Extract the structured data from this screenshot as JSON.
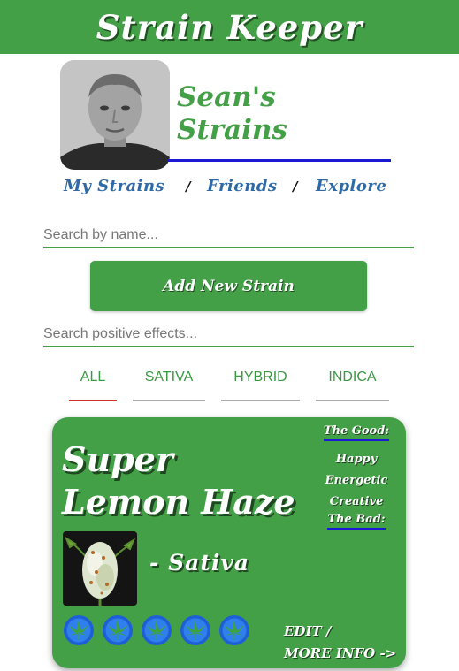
{
  "app": {
    "title": "Strain Keeper"
  },
  "profile": {
    "title_line1": "Sean's",
    "title_line2": "Strains"
  },
  "nav": {
    "items": [
      "My Strains",
      "Friends",
      "Explore"
    ],
    "separator": "/"
  },
  "search": {
    "name_placeholder": "Search by name...",
    "effects_placeholder": "Search positive effects..."
  },
  "actions": {
    "add_label": "Add New Strain"
  },
  "tabs": [
    {
      "label": "ALL",
      "active": true
    },
    {
      "label": "SATIVA",
      "active": false
    },
    {
      "label": "HYBRID",
      "active": false
    },
    {
      "label": "INDICA",
      "active": false
    }
  ],
  "strain": {
    "name_line1": "Super",
    "name_line2": "Lemon Haze",
    "type": "- Sativa",
    "good_heading": "The Good:",
    "good_effects": [
      "Happy",
      "Energetic",
      "Creative"
    ],
    "bad_heading": "The Bad:",
    "rating": 5,
    "rating_max": 5,
    "more_line1": "EDIT /",
    "more_line2": "MORE INFO ->"
  },
  "colors": {
    "brand_green": "#43a047",
    "link_blue": "#2f6aa8",
    "underline_blue": "#1a1ad4",
    "active_tab": "#d32f2f"
  }
}
